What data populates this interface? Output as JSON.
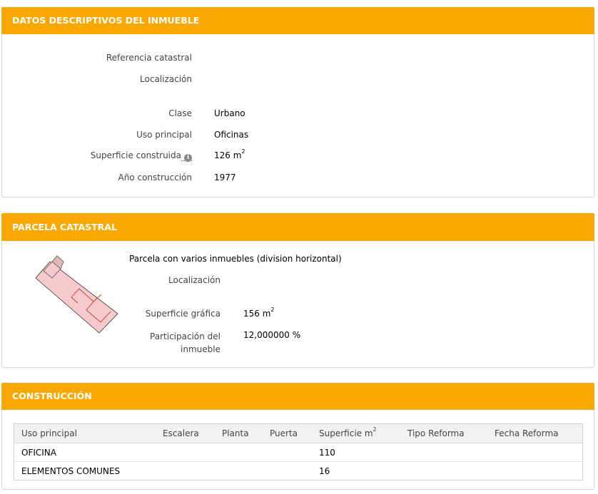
{
  "panel1": {
    "title": "DATOS DESCRIPTIVOS DEL INMUEBLE",
    "fields": [
      {
        "label": "Referencia catastral",
        "value": ""
      },
      {
        "label": "Localización",
        "value": ""
      },
      {
        "label": "Clase",
        "value": "Urbano"
      },
      {
        "label": "Uso principal",
        "value": "Oficinas"
      },
      {
        "label": "Superficie construida",
        "value": "126 m",
        "unit_sup": "2"
      },
      {
        "label": "Año construcción",
        "value": "1977"
      }
    ],
    "info_icon": "i"
  },
  "panel2": {
    "title": "PARCELA CATASTRAL",
    "heading": "Parcela con varios inmuebles (division horizontal)",
    "fields": [
      {
        "label": "Localización",
        "value": ""
      },
      {
        "label": "Superficie gráfica",
        "value": "156 m",
        "unit_sup": "2"
      },
      {
        "label_line1": "Participación del",
        "label_line2": "inmueble",
        "value": "12,000000 %"
      }
    ],
    "parcel_fill": "#f6c9cc",
    "parcel_stroke": "#c0392b"
  },
  "panel3": {
    "title": "CONSTRUCCIÓN",
    "columns": [
      "Uso principal",
      "Escalera",
      "Planta",
      "Puerta",
      "Superficie m",
      "Tipo Reforma",
      "Fecha Reforma"
    ],
    "superficie_sup": "2",
    "rows": [
      [
        "OFICINA",
        "",
        "",
        "",
        "110",
        "",
        ""
      ],
      [
        "ELEMENTOS COMUNES",
        "",
        "",
        "",
        "16",
        "",
        ""
      ]
    ]
  },
  "colors": {
    "header": "#f8a800"
  }
}
